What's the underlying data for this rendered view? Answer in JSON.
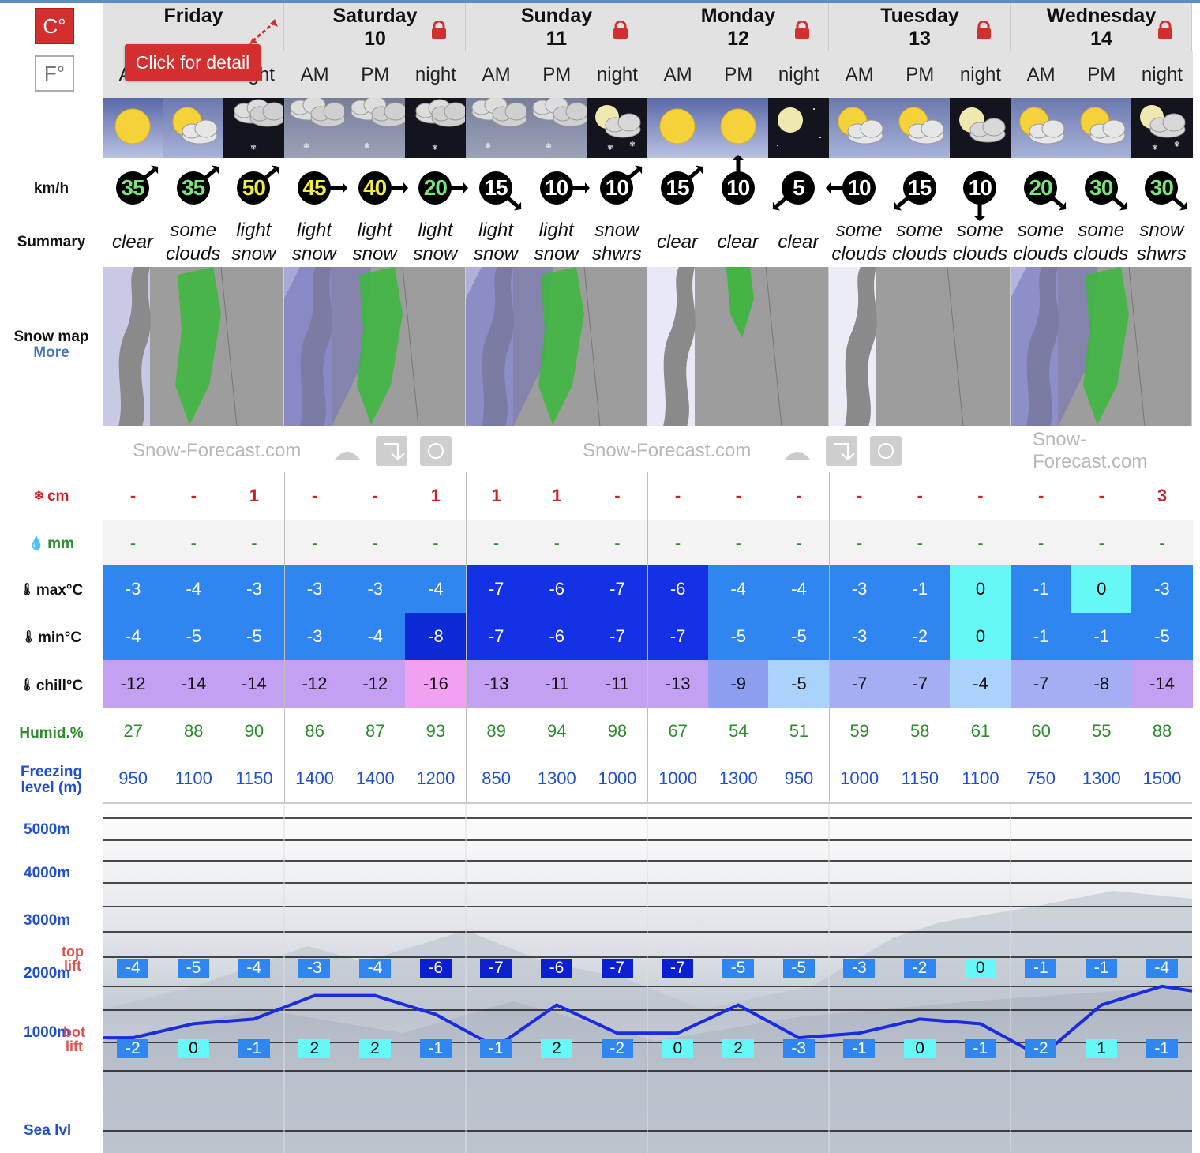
{
  "units": {
    "celsius": "C°",
    "fahrenheit": "F°"
  },
  "tooltip": "Click for detail",
  "labels": {
    "wind_unit": "km/h",
    "summary": "Summary",
    "snow_map": "Snow map",
    "more": "More",
    "snow": "cm",
    "rain": "mm",
    "max": "max°C",
    "min": "min°C",
    "chill": "chill°C",
    "humid": "Humid.%",
    "freezing1": "Freezing",
    "freezing2": "level (m)",
    "top1": "top",
    "top2": "lift",
    "bot1": "bot",
    "bot2": "lift"
  },
  "brand": "Snow-Forecast.com",
  "days": [
    {
      "name": "Friday",
      "num": "",
      "locked": false
    },
    {
      "name": "Saturday",
      "num": "10",
      "locked": true
    },
    {
      "name": "Sunday",
      "num": "11",
      "locked": true
    },
    {
      "name": "Monday",
      "num": "12",
      "locked": true
    },
    {
      "name": "Tuesday",
      "num": "13",
      "locked": true
    },
    {
      "name": "Wednesday",
      "num": "14",
      "locked": true
    }
  ],
  "periods": [
    "AM",
    "PM",
    "night",
    "AM",
    "PM",
    "night",
    "AM",
    "PM",
    "night",
    "AM",
    "PM",
    "night",
    "AM",
    "PM",
    "night",
    "AM",
    "PM",
    "night"
  ],
  "icons": [
    "sun-icon",
    "sun-cloud-icon",
    "cloud-snow-night-icon",
    "cloud-snow-icon",
    "cloud-snow-icon",
    "cloud-snow-night-icon",
    "cloud-snow-icon",
    "cloud-snow-icon",
    "moon-cloud-snow-icon",
    "sun-icon",
    "sun-icon",
    "moon-icon",
    "sun-cloud-icon",
    "sun-cloud-icon",
    "moon-cloud-icon",
    "sun-cloud-icon",
    "sun-cloud-icon",
    "moon-cloud-snow-icon"
  ],
  "wind": [
    {
      "v": "35",
      "c": "#7de37d",
      "dir": "ne"
    },
    {
      "v": "35",
      "c": "#7de37d",
      "dir": "ne"
    },
    {
      "v": "50",
      "c": "#f2ef3a",
      "dir": "ne"
    },
    {
      "v": "45",
      "c": "#f2ef3a",
      "dir": "e"
    },
    {
      "v": "40",
      "c": "#f2ef3a",
      "dir": "e"
    },
    {
      "v": "20",
      "c": "#7de37d",
      "dir": "e"
    },
    {
      "v": "15",
      "c": "#ffffff",
      "dir": "se"
    },
    {
      "v": "10",
      "c": "#ffffff",
      "dir": "e"
    },
    {
      "v": "10",
      "c": "#ffffff",
      "dir": "ne"
    },
    {
      "v": "15",
      "c": "#ffffff",
      "dir": "ne"
    },
    {
      "v": "10",
      "c": "#ffffff",
      "dir": "n"
    },
    {
      "v": "5",
      "c": "#ffffff",
      "dir": "sw"
    },
    {
      "v": "10",
      "c": "#ffffff",
      "dir": "w"
    },
    {
      "v": "15",
      "c": "#ffffff",
      "dir": "sw"
    },
    {
      "v": "10",
      "c": "#ffffff",
      "dir": "s"
    },
    {
      "v": "20",
      "c": "#7de37d",
      "dir": "se"
    },
    {
      "v": "30",
      "c": "#7de37d",
      "dir": "se"
    },
    {
      "v": "30",
      "c": "#7de37d",
      "dir": "se"
    }
  ],
  "summaries": [
    "clear",
    "some clouds",
    "light snow",
    "light snow",
    "light snow",
    "light snow",
    "light snow",
    "light snow",
    "snow shwrs",
    "clear",
    "clear",
    "clear",
    "some clouds",
    "some clouds",
    "some clouds",
    "some clouds",
    "some clouds",
    "snow shwrs"
  ],
  "snow": [
    "-",
    "-",
    "1",
    "-",
    "-",
    "1",
    "1",
    "1",
    "-",
    "-",
    "-",
    "-",
    "-",
    "-",
    "-",
    "-",
    "-",
    "3"
  ],
  "rain": [
    "-",
    "-",
    "-",
    "-",
    "-",
    "-",
    "-",
    "-",
    "-",
    "-",
    "-",
    "-",
    "-",
    "-",
    "-",
    "-",
    "-",
    "-"
  ],
  "max": [
    "-3",
    "-4",
    "-3",
    "-3",
    "-3",
    "-4",
    "-7",
    "-6",
    "-7",
    "-6",
    "-4",
    "-4",
    "-3",
    "-1",
    "0",
    "-1",
    "0",
    "-3"
  ],
  "min": [
    "-4",
    "-5",
    "-5",
    "-3",
    "-4",
    "-8",
    "-7",
    "-6",
    "-7",
    "-7",
    "-5",
    "-5",
    "-3",
    "-2",
    "0",
    "-1",
    "-1",
    "-5"
  ],
  "chill": [
    "-12",
    "-14",
    "-14",
    "-12",
    "-12",
    "-16",
    "-13",
    "-11",
    "-11",
    "-13",
    "-9",
    "-5",
    "-7",
    "-7",
    "-4",
    "-7",
    "-8",
    "-14"
  ],
  "humid": [
    "27",
    "88",
    "90",
    "86",
    "87",
    "93",
    "89",
    "94",
    "98",
    "67",
    "54",
    "51",
    "59",
    "58",
    "61",
    "60",
    "55",
    "88"
  ],
  "freezing": [
    "950",
    "1100",
    "1150",
    "1400",
    "1400",
    "1200",
    "850",
    "1300",
    "1000",
    "1000",
    "1300",
    "950",
    "1000",
    "1150",
    "1100",
    "750",
    "1300",
    "1500"
  ],
  "colors": {
    "red": "#cc2222",
    "green": "#2e8b2e",
    "blue_label": "#2050d0"
  },
  "chart_data": {
    "type": "line",
    "y_ticks": [
      "5000m",
      "4000m",
      "3000m",
      "2000m",
      "1000m",
      "Sea lvl"
    ],
    "top_lift_temps": [
      "-4",
      "-5",
      "-4",
      "-3",
      "-4",
      "-6",
      "-7",
      "-6",
      "-7",
      "-7",
      "-5",
      "-5",
      "-3",
      "-2",
      "0",
      "-1",
      "-1",
      "-4"
    ],
    "bot_lift_temps": [
      "-2",
      "0",
      "-1",
      "2",
      "2",
      "-1",
      "-1",
      "2",
      "-2",
      "0",
      "2",
      "-3",
      "-1",
      "0",
      "-1",
      "-2",
      "1",
      "-1"
    ],
    "freezing_level_m": [
      950,
      1100,
      1150,
      1400,
      1400,
      1200,
      850,
      1300,
      1000,
      1000,
      1300,
      950,
      1000,
      1150,
      1100,
      750,
      1300,
      1500
    ]
  }
}
